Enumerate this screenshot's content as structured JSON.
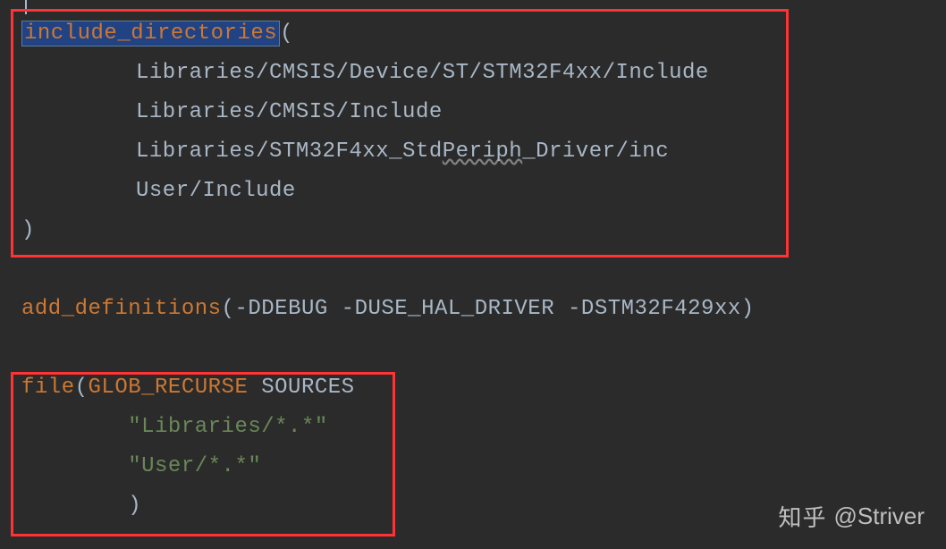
{
  "code": {
    "line1": {
      "keyword": "include_directories",
      "paren_open": "("
    },
    "line2": {
      "indent": "          ",
      "path": "Libraries/CMSIS/Device/ST/STM32F4xx/Include"
    },
    "line3": {
      "indent": "          ",
      "path": "Libraries/CMSIS/Include"
    },
    "line4": {
      "indent": "          ",
      "path_part1": "Libraries/STM32F4xx_Std",
      "path_squiggle": "Periph",
      "path_part2": "_Driver/inc"
    },
    "line5": {
      "indent": "          ",
      "path": "User/Include"
    },
    "line6": {
      "paren_close": ")"
    },
    "line7": {
      "blank": ""
    },
    "line8": {
      "keyword": "add_definitions",
      "paren_open": "(",
      "args": "-DDEBUG -DUSE_HAL_DRIVER -DSTM32F429xx",
      "paren_close": ")"
    },
    "line9": {
      "blank": ""
    },
    "line10": {
      "keyword": "file",
      "paren_open": "(",
      "glob_keyword": "GLOB_RECURSE",
      "variable": " SOURCES"
    },
    "line11": {
      "indent": "        ",
      "string": "\"Libraries/*.*\""
    },
    "line12": {
      "indent": "        ",
      "string": "\"User/*.*\""
    },
    "line13": {
      "indent": "        ",
      "paren_close": ")"
    }
  },
  "watermark": {
    "logo": "知乎",
    "author": "@Striver"
  }
}
